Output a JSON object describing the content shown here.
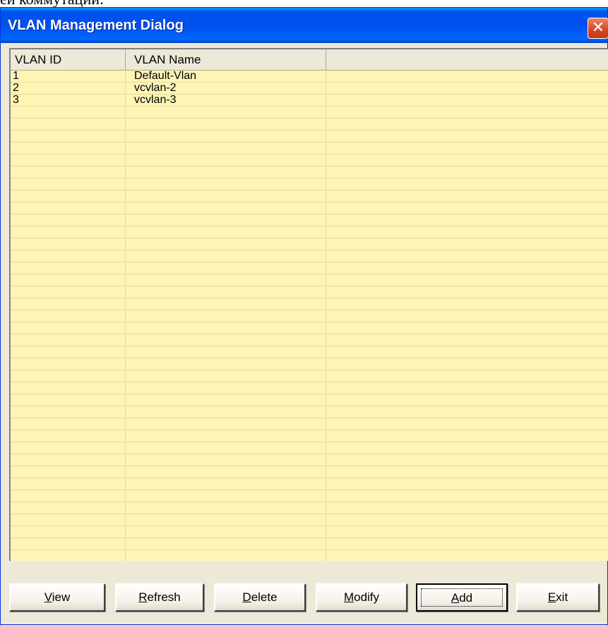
{
  "page_caption": "ей коммутации:",
  "window": {
    "title": "VLAN Management Dialog",
    "close_glyph": "✕"
  },
  "table": {
    "columns": [
      "VLAN ID",
      "VLAN Name",
      ""
    ],
    "rows": [
      {
        "id": "1",
        "name": "Default-Vlan"
      },
      {
        "id": "2",
        "name": "vcvlan-2"
      },
      {
        "id": "3",
        "name": "vcvlan-3"
      }
    ]
  },
  "buttons": [
    {
      "key": "view",
      "mnemonic": "V",
      "rest": "iew"
    },
    {
      "key": "refresh",
      "mnemonic": "R",
      "rest": "efresh"
    },
    {
      "key": "delete",
      "mnemonic": "D",
      "rest": "elete"
    },
    {
      "key": "modify",
      "mnemonic": "M",
      "rest": "odify"
    },
    {
      "key": "add",
      "mnemonic": "A",
      "rest": "dd"
    },
    {
      "key": "exit",
      "mnemonic": "E",
      "rest": "xit"
    }
  ],
  "colors": {
    "title_bar": "#0054e3",
    "list_background": "#fff5b5",
    "dialog_face": "#ece9d8",
    "close_button": "#d5451f"
  }
}
